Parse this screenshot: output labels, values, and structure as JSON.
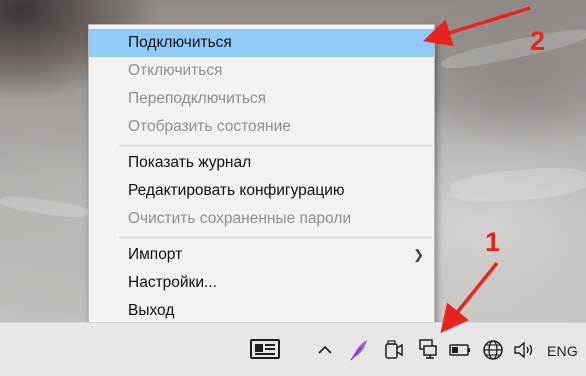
{
  "context_menu": {
    "items": [
      {
        "label": "Подключиться",
        "state": "highlighted"
      },
      {
        "label": "Отключиться",
        "state": "disabled"
      },
      {
        "label": "Переподключиться",
        "state": "disabled"
      },
      {
        "label": "Отобразить состояние",
        "state": "disabled"
      },
      {
        "label": "Показать журнал",
        "state": "enabled"
      },
      {
        "label": "Редактировать конфигурацию",
        "state": "enabled"
      },
      {
        "label": "Очистить сохраненные пароли",
        "state": "disabled"
      },
      {
        "label": "Импорт",
        "state": "enabled",
        "submenu": true
      },
      {
        "label": "Настройки...",
        "state": "enabled"
      },
      {
        "label": "Выход",
        "state": "enabled"
      }
    ]
  },
  "taskbar": {
    "language": "ENG",
    "tray_icons": [
      "news-icon",
      "show-hidden-icons-chevron",
      "feather-app-icon",
      "camera-icon",
      "openvpn-network-icon",
      "battery-icon",
      "network-globe-icon",
      "volume-icon"
    ]
  },
  "annotations": {
    "label_1": "1",
    "label_2": "2",
    "arrow_color": "#e8241c"
  },
  "colors": {
    "menu_highlight": "#91c9f7",
    "menu_background": "#f2f2f2",
    "disabled_text": "#8f8f8f",
    "taskbar": "#e8e5e6"
  }
}
